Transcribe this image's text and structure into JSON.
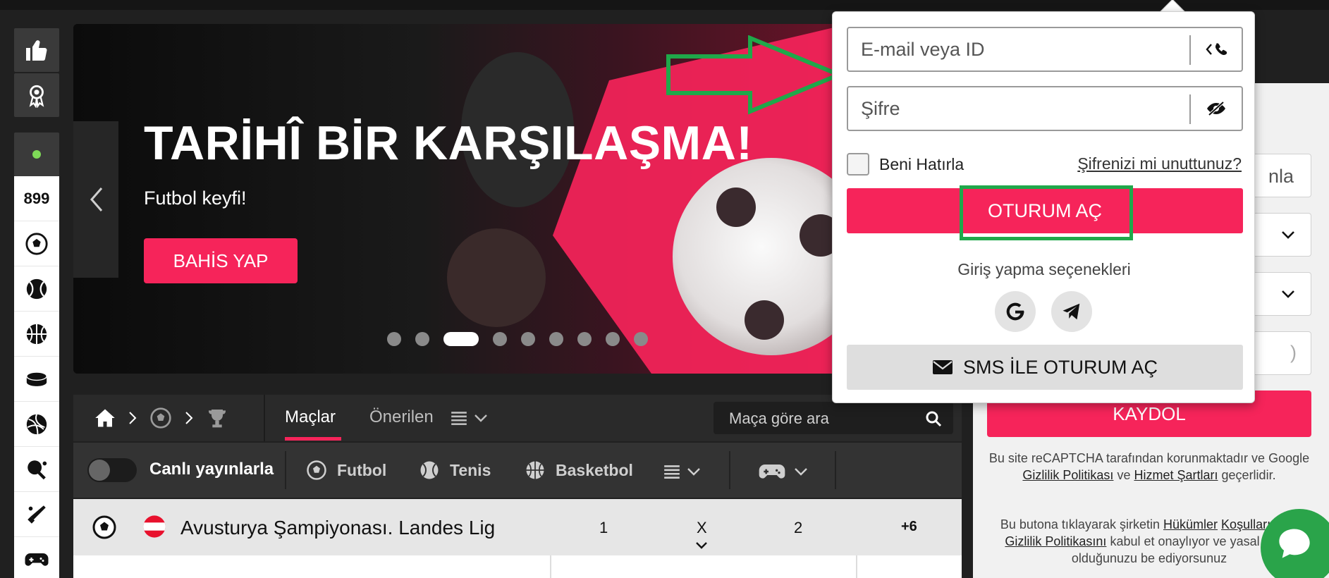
{
  "banner": {
    "title": "TARİHÎ BİR KARŞILAŞMA!",
    "subtitle": "Futbol keyfi!",
    "cta": "BAHİS YAP",
    "slide_count": 9,
    "active_slide": 3
  },
  "rail": {
    "count": "899",
    "items": [
      "like-icon",
      "award-icon",
      "live-dot-icon",
      "football-icon",
      "tennis-icon",
      "basketball-icon",
      "hockey-icon",
      "volleyball-icon",
      "table-tennis-icon",
      "cricket-icon",
      "esports-icon"
    ]
  },
  "nav": {
    "tabs": [
      "Maçlar",
      "Önerilen"
    ],
    "active_tab": "Maçlar",
    "search_placeholder": "Maça göre ara"
  },
  "filter": {
    "toggle_label": "Canlı yayınlarla",
    "toggle_on": false,
    "sports": [
      "Futbol",
      "Tenis",
      "Basketbol"
    ]
  },
  "league": {
    "name": "Avusturya Şampiyonası. Landes Lig",
    "col_1": "1",
    "col_x": "X",
    "col_2": "2",
    "more": "+6"
  },
  "login": {
    "email_placeholder": "E-mail veya ID",
    "password_placeholder": "Şifre",
    "remember_label": "Beni Hatırla",
    "forgot_link": "Şifrenizi mi unuttunuz?",
    "login_button": "OTURUM AÇ",
    "options_label": "Giriş yapma seçenekleri",
    "sms_button": "SMS İLE OTURUM AÇ"
  },
  "register": {
    "partial_text": "nla",
    "partial_paren": ")",
    "button": "KAYDOL",
    "recaptcha_1": "Bu site reCAPTCHA tarafından korunmaktadır ve Google",
    "privacy_link": "Gizlilik Politikası",
    "and": "ve",
    "terms_link": "Hizmet Şartları",
    "recaptcha_end": "geçerlidir.",
    "consent_1": "Bu butona tıklayarak şirketin",
    "terms_link_2": "Hükümler",
    "terms_link_3": "Koşullarını",
    "and_2": "ve",
    "privacy_link_2": "Gizlilik Politikasını",
    "consent_2": "kabul et",
    "consent_3": "onaylıyor ve yasal yaşta olduğunuzu be",
    "consent_4": "ediyorsunuz"
  },
  "colors": {
    "accent": "#f6245a",
    "highlight": "#1fa84a"
  }
}
